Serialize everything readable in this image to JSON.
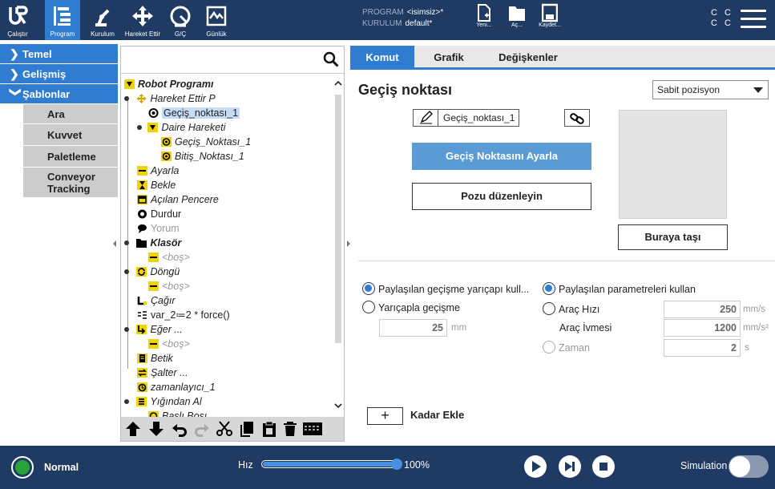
{
  "header": {
    "nav": [
      {
        "label": "Çalıştır",
        "icon": "ur-logo-icon"
      },
      {
        "label": "Program",
        "icon": "program-icon",
        "active": true
      },
      {
        "label": "Kurulum",
        "icon": "robot-arm-icon"
      },
      {
        "label": "Hareket Ettir",
        "icon": "move-arrows-icon"
      },
      {
        "label": "G/Ç",
        "icon": "io-gauge-icon"
      },
      {
        "label": "Günlük",
        "icon": "log-chart-icon"
      }
    ],
    "program_label": "PROGRAM",
    "program_value": "<isimsiz>*",
    "installation_label": "KURULUM",
    "installation_value": "default*",
    "file_buttons": [
      {
        "label": "Yeni...",
        "icon": "new-file-icon"
      },
      {
        "label": "Aç...",
        "icon": "folder-icon"
      },
      {
        "label": "Kaydet...",
        "icon": "save-icon"
      }
    ],
    "cc_line1": "C C",
    "cc_line2": "C C"
  },
  "left_menu": {
    "sections": [
      {
        "label": "Temel",
        "expanded": false
      },
      {
        "label": "Gelişmiş",
        "expanded": false
      },
      {
        "label": "Şablonlar",
        "expanded": true
      }
    ],
    "templates": [
      "Ara",
      "Kuvvet",
      "Paletleme",
      "Conveyor Tracking"
    ]
  },
  "tree": {
    "search_placeholder": "",
    "nodes": [
      {
        "text": "Robot Programı",
        "icon": "triangle-down-icon"
      },
      {
        "text": "Hareket Ettir P",
        "icon": "move-arrows-icon"
      },
      {
        "text": "Geçiş_noktası_1",
        "icon": "waypoint-icon",
        "selected": true
      },
      {
        "text": "Daire Hareketi",
        "icon": "triangle-down-icon"
      },
      {
        "text": "Geçiş_Noktası_1",
        "icon": "waypoint-yellow-icon"
      },
      {
        "text": "Bitiş_Noktası_1",
        "icon": "waypoint-yellow-icon"
      },
      {
        "text": "Ayarla",
        "icon": "yellow-bar-icon"
      },
      {
        "text": "Bekle",
        "icon": "hourglass-icon"
      },
      {
        "text": "Açılan Pencere",
        "icon": "popup-icon"
      },
      {
        "text": "Durdur",
        "icon": "stop-icon"
      },
      {
        "text": "Yorum",
        "icon": "comment-icon"
      },
      {
        "text": "Klasör",
        "icon": "folder-icon"
      },
      {
        "text": "<boş>",
        "icon": "yellow-bar-icon"
      },
      {
        "text": "Döngü",
        "icon": "loop-icon"
      },
      {
        "text": "<boş>",
        "icon": "yellow-bar-icon"
      },
      {
        "text": "Çağır",
        "icon": "call-icon"
      },
      {
        "text": "var_2≔2 * force()",
        "icon": "assignment-icon"
      },
      {
        "text": "Eğer ...",
        "icon": "if-icon"
      },
      {
        "text": "<boş>",
        "icon": "yellow-bar-icon"
      },
      {
        "text": "Betik",
        "icon": "script-icon"
      },
      {
        "text": "Şalter ...",
        "icon": "switch-icon"
      },
      {
        "text": "zamanlayıcı_1",
        "icon": "timer-icon"
      },
      {
        "text": "Yığından Al",
        "icon": "stack-icon"
      },
      {
        "text": "Baslı Bosı",
        "icon": "waypoint-yellow-icon"
      }
    ],
    "toolbar": [
      "move-up-icon",
      "move-down-icon",
      "undo-icon",
      "redo-icon",
      "cut-icon",
      "copy-icon",
      "paste-icon",
      "delete-icon",
      "suppress-icon"
    ]
  },
  "tabs": [
    {
      "label": "Komut",
      "active": true
    },
    {
      "label": "Grafik",
      "active": false
    },
    {
      "label": "Değişkenler",
      "active": false
    }
  ],
  "waypoint": {
    "title": "Geçiş noktası",
    "position_type": "Sabit pozisyon",
    "name": "Geçiş_noktası_1",
    "set_button": "Geçiş Noktasını Ayarla",
    "edit_button": "Pozu düzenleyin",
    "move_here_button": "Buraya taşı"
  },
  "blend": {
    "shared_blend_label": "Paylaşılan geçişme yarıçapı kull...",
    "shared_blend_selected": true,
    "radius_blend_label": "Yarıçapla geçişme",
    "radius_value": "25",
    "radius_unit": "mm"
  },
  "params": {
    "shared_params_label": "Paylaşılan parametreleri kullan",
    "shared_params_selected": true,
    "tool_speed_label": "Araç Hızı",
    "tool_speed_value": "250",
    "tool_speed_unit": "mm/s",
    "tool_accel_label": "Araç İvmesi",
    "tool_accel_value": "1200",
    "tool_accel_unit": "mm/s²",
    "time_label": "Zaman",
    "time_value": "2",
    "time_unit": "s"
  },
  "add_until": {
    "button": "+",
    "label": "Kadar Ekle"
  },
  "footer": {
    "status": "Normal",
    "status_color": "#27a33a",
    "speed_label": "Hız",
    "speed_value": "100%",
    "speed_fraction": 1.0,
    "simulation_label": "Simulation",
    "simulation_on": false
  },
  "colors": {
    "header_bg": "#1f3a63",
    "accent": "#2f7cd0",
    "button_blue": "#5b9bd5"
  }
}
